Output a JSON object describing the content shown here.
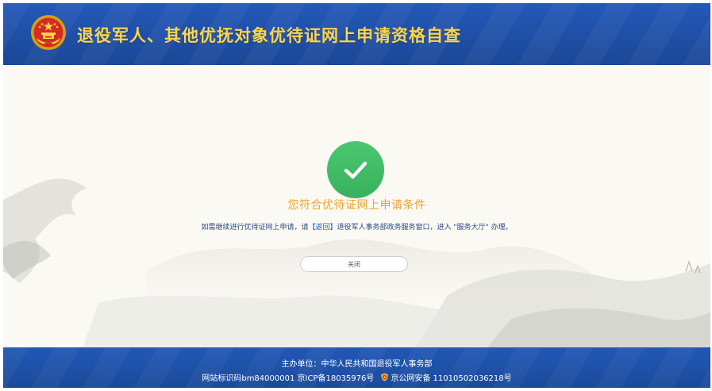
{
  "header": {
    "title": "退役军人、其他优抚对象优待证网上申请资格自查",
    "emblem_icon": "national-emblem-icon",
    "background_color": "#2359b8",
    "title_color": "#ffd64a"
  },
  "result": {
    "status_icon": "checkmark-icon",
    "status_color": "#3fbb64",
    "title": "您符合优待证网上申请条件",
    "title_color": "#f0a22a",
    "instruction_before": "如需继续进行优待证网上申请，请",
    "instruction_link": "【返回】",
    "instruction_after": "退役军人事务部政务服务窗口，进入 \"服务大厅\" 办理。"
  },
  "actions": {
    "close_label": "关闭"
  },
  "footer": {
    "sponsor": "主办单位：中华人民共和国退役军人事务部",
    "site_id": "网站标识码bm84000001 京ICP备18035976号",
    "police_icon": "police-badge-icon",
    "police_record": "京公网安备 11010502036218号"
  }
}
